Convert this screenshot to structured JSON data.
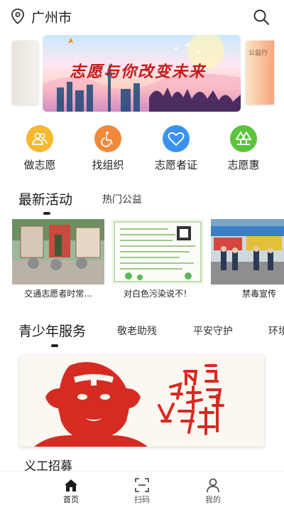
{
  "header": {
    "city": "广州市",
    "location_icon": "location-pin-icon",
    "search_icon": "search-icon"
  },
  "banner": {
    "title": "志愿与你改变未来",
    "right_card_text": "公益行"
  },
  "quick_menu": [
    {
      "label": "做志愿",
      "icon": "people-icon",
      "color": "#f5b82e"
    },
    {
      "label": "找组织",
      "icon": "wheelchair-icon",
      "color": "#f08a3a"
    },
    {
      "label": "志愿者证",
      "icon": "heart-icon",
      "color": "#3a92f0"
    },
    {
      "label": "志愿惠",
      "icon": "tree-icon",
      "color": "#5cc33c"
    }
  ],
  "activities": {
    "tabs": [
      "最新活动",
      "热门公益"
    ],
    "cards": [
      {
        "caption": "交通志愿者时常..."
      },
      {
        "caption": "对白色污染说不！"
      },
      {
        "caption": "禁毒宣传"
      }
    ]
  },
  "youth": {
    "tabs": [
      "青少年服务",
      "敬老助残",
      "平安守护",
      "环境"
    ],
    "poster_heading": "义工招募",
    "poster_calligraphy": "向雷锋同志学习"
  },
  "bottom_nav": [
    {
      "label": "首页",
      "icon": "home-icon"
    },
    {
      "label": "扫码",
      "icon": "scan-icon"
    },
    {
      "label": "我的",
      "icon": "user-icon"
    }
  ],
  "colors": {
    "accent_red": "#c41a1a",
    "text_dark": "#1a1a1a"
  }
}
